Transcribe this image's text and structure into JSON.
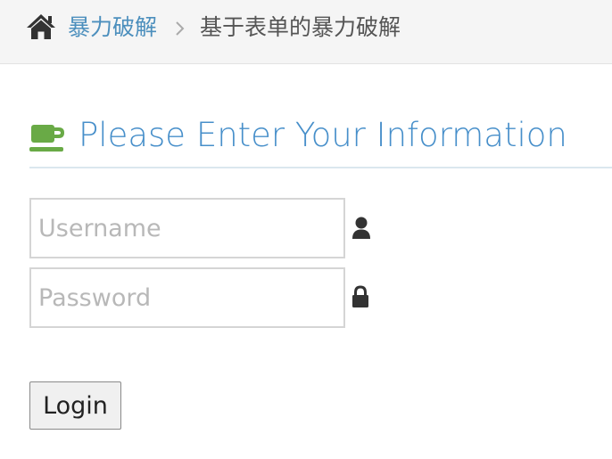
{
  "breadcrumb": {
    "home_icon": "home-icon",
    "parent_label": "暴力破解",
    "separator_icon": "chevron-right-icon",
    "current_label": "基于表单的暴力破解"
  },
  "header": {
    "icon": "coffee-icon",
    "title": "Please Enter Your Information"
  },
  "form": {
    "username": {
      "value": "",
      "placeholder": "Username",
      "icon": "user-icon"
    },
    "password": {
      "value": "",
      "placeholder": "Password",
      "icon": "lock-icon"
    },
    "login_label": "Login"
  },
  "colors": {
    "link": "#4c8fbd",
    "title": "#478fca",
    "coffee_icon": "#69aa46",
    "breadcrumb_background": "#f5f5f5",
    "header_border": "#dbe7ee",
    "input_border": "#d5d5d5"
  }
}
